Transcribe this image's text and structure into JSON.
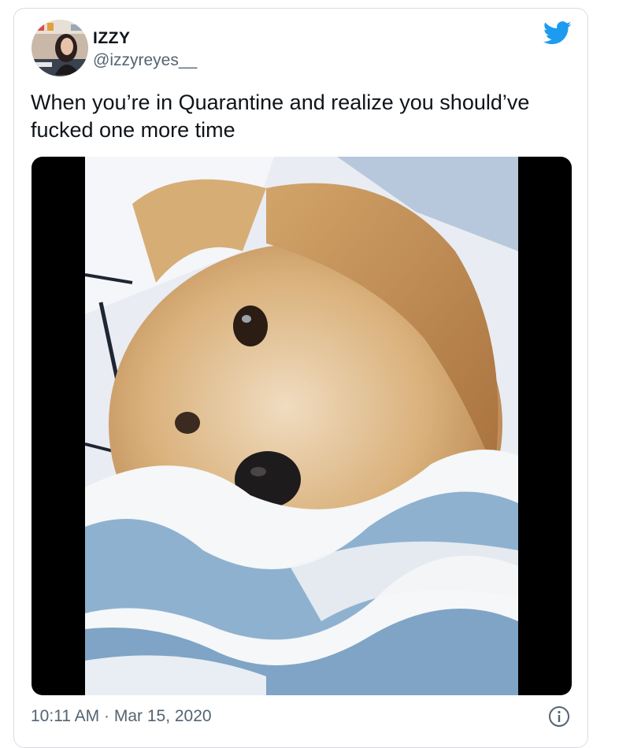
{
  "tweet": {
    "author": {
      "display_name": "IZZY",
      "handle": "@izzyreyes__"
    },
    "text": "When you’re in Quarantine and realize you should’ve fucked one more time",
    "media": {
      "type": "video",
      "subject": "dog-under-blanket"
    },
    "timestamp": "10:11 AM · Mar 15, 2020",
    "icons": {
      "brand": "twitter-bird-icon",
      "info": "info-icon"
    },
    "colors": {
      "brand": "#1d9bf0",
      "secondary_text": "#536471",
      "border": "#d8dde2"
    }
  }
}
